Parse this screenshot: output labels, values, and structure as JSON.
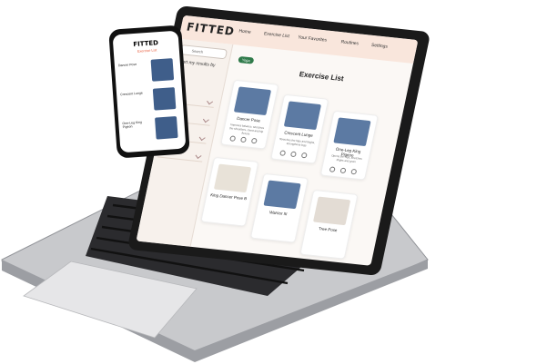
{
  "laptop": {
    "brand": "FITTED",
    "nav": [
      "Home",
      "Exercise List",
      "Your Favorites",
      "Routines",
      "Settings"
    ],
    "search_placeholder": "Search",
    "sort_label": "Sort my results by",
    "filter_chip": "Yoga",
    "page_title": "Exercise List",
    "cards": [
      {
        "title": "Dancer Pose",
        "desc": "Improves balance, stretches the shoulders, chest and hip flexors"
      },
      {
        "title": "Crescent Lunge",
        "desc": "Stretches the hips and thighs, strengthens legs"
      },
      {
        "title": "One-Leg King Pigeon",
        "desc": "Opens the hips, stretches thighs and groin"
      },
      {
        "title": "King Dancer Pose B",
        "desc": ""
      },
      {
        "title": "Warrior III",
        "desc": ""
      },
      {
        "title": "Tree Pose",
        "desc": ""
      }
    ]
  },
  "phone": {
    "brand": "FITTED",
    "subtitle": "Exercise List",
    "items": [
      {
        "title": "Dancer Pose"
      },
      {
        "title": "Crescent Lunge"
      },
      {
        "title": "One-Leg King Pigeon"
      }
    ]
  },
  "colors": {
    "accent": "#e85a3a",
    "chip": "#2f7a4a",
    "topbar": "#f9e6dc"
  }
}
